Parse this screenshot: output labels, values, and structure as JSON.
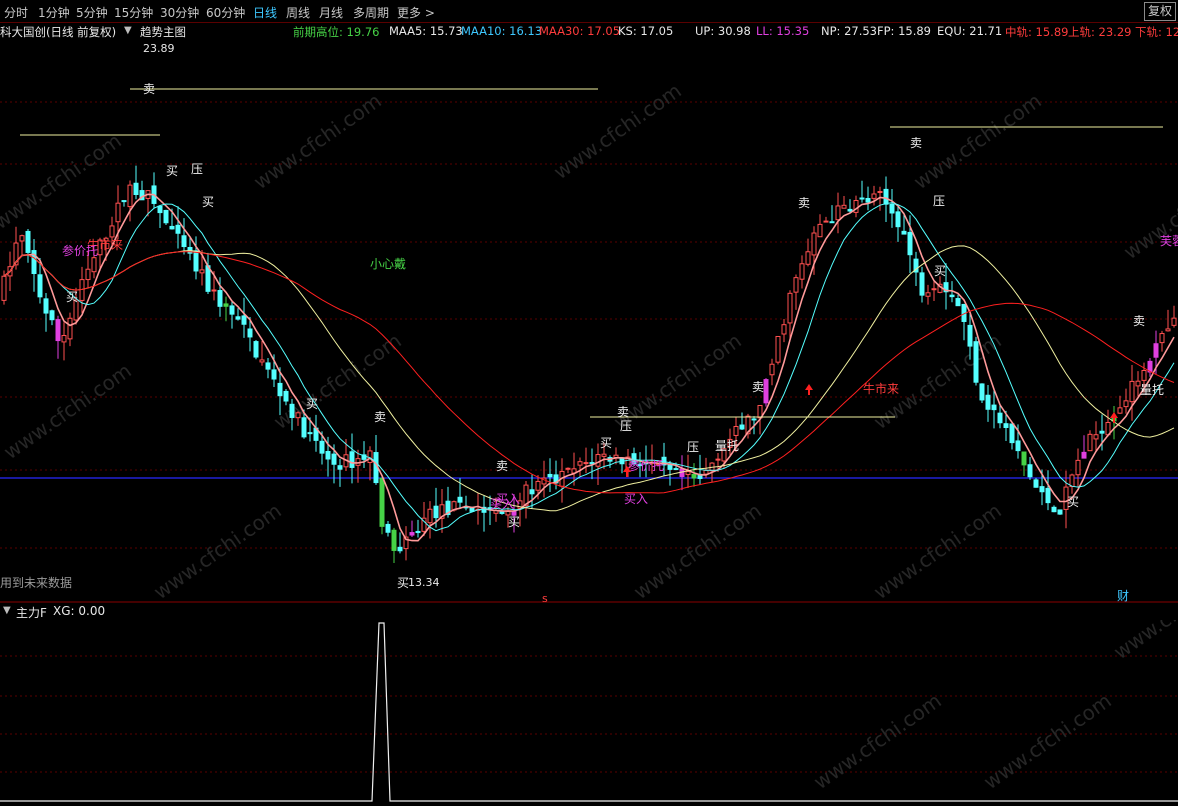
{
  "toolbar": {
    "periods": [
      {
        "label": "分时",
        "active": false
      },
      {
        "label": "1分钟",
        "active": false
      },
      {
        "label": "5分钟",
        "active": false
      },
      {
        "label": "15分钟",
        "active": false
      },
      {
        "label": "30分钟",
        "active": false
      },
      {
        "label": "60分钟",
        "active": false
      },
      {
        "label": "日线",
        "active": true
      },
      {
        "label": "周线",
        "active": false
      },
      {
        "label": "月线",
        "active": false
      },
      {
        "label": "多周期",
        "active": false
      },
      {
        "label": "更多 >",
        "active": false
      }
    ],
    "restore_label": "复权"
  },
  "infobar": {
    "security": "科大国创(日线 前复权)",
    "indicator_name": "趋势主图",
    "items": [
      {
        "text": "前期高位: 19.76",
        "color": "#46d246"
      },
      {
        "text": "MAA5: 15.73",
        "color": "#e8e8e8"
      },
      {
        "text": "MAA10: 16.13",
        "color": "#3ec8ff"
      },
      {
        "text": "MAA30: 17.05",
        "color": "#ff3c3c"
      },
      {
        "text": "KS: 17.05",
        "color": "#e8e8e8"
      },
      {
        "text": "UP: 30.98",
        "color": "#e8e8e8"
      },
      {
        "text": "LL: 15.35",
        "color": "#e040e0"
      },
      {
        "text": "NP: 27.53",
        "color": "#e8e8e8"
      },
      {
        "text": "FP: 15.89",
        "color": "#e8e8e8"
      },
      {
        "text": "EQU: 21.71",
        "color": "#e8e8e8"
      },
      {
        "text": "中轨: 15.89",
        "color": "#ff3c3c"
      },
      {
        "text": "上轨: 23.29",
        "color": "#ff3c3c"
      },
      {
        "text": "下轨: 12.",
        "color": "#ff3c3c"
      }
    ]
  },
  "main_chart": {
    "high_label": "23.89",
    "low_label": "13.34",
    "warning_note": "用到未来数据",
    "center_note": "小心戴",
    "marker_s": "s",
    "marker_cai": "财",
    "signals": [
      {
        "text": "卖",
        "color": "#f0f0f0"
      },
      {
        "text": "卖",
        "color": "#f0f0f0"
      },
      {
        "text": "卖",
        "color": "#f0f0f0"
      },
      {
        "text": "卖",
        "color": "#f0f0f0"
      },
      {
        "text": "卖",
        "color": "#f0f0f0"
      },
      {
        "text": "卖",
        "color": "#f0f0f0"
      },
      {
        "text": "卖",
        "color": "#f0f0f0"
      },
      {
        "text": "卖",
        "color": "#f0f0f0"
      },
      {
        "text": "买",
        "color": "#f0f0f0"
      },
      {
        "text": "买",
        "color": "#f0f0f0"
      },
      {
        "text": "买",
        "color": "#f0f0f0"
      },
      {
        "text": "买",
        "color": "#f0f0f0"
      },
      {
        "text": "买",
        "color": "#f0f0f0"
      },
      {
        "text": "买",
        "color": "#f0f0f0"
      },
      {
        "text": "买",
        "color": "#f0f0f0"
      },
      {
        "text": "买",
        "color": "#f0f0f0"
      },
      {
        "text": "买",
        "color": "#f0f0f0"
      },
      {
        "text": "压",
        "color": "#f0f0f0"
      },
      {
        "text": "压",
        "color": "#f0f0f0"
      },
      {
        "text": "压",
        "color": "#f0f0f0"
      },
      {
        "text": "压",
        "color": "#f0f0f0"
      },
      {
        "text": "量托",
        "color": "#f0f0f0"
      },
      {
        "text": "量托",
        "color": "#f0f0f0"
      },
      {
        "text": "牛市来",
        "color": "#ff3c3c"
      },
      {
        "text": "牛市来",
        "color": "#ff3c3c"
      },
      {
        "text": "参价托",
        "color": "#e040e0"
      },
      {
        "text": "参价托",
        "color": "#e040e0"
      },
      {
        "text": "买入",
        "color": "#e040e0"
      },
      {
        "text": "买入",
        "color": "#e040e0"
      },
      {
        "text": "买入",
        "color": "#e040e0"
      },
      {
        "text": "芙蓉",
        "color": "#e040e0"
      }
    ]
  },
  "sub_chart": {
    "title": "主力F",
    "value_text": "XG: 0.00"
  },
  "watermark": "www.cfchi.com",
  "colors": {
    "background": "#000000",
    "grid": "#5a0000",
    "up_candle": "#ff5050",
    "down_candle": "#54ffff",
    "ma_short": "#ff9a9a",
    "ma_mid": "#54ffff",
    "ma_long": "#f0f0a0",
    "ma_red": "#ff2020",
    "blue_line": "#2828ff",
    "resistance": "#f0f0a0"
  }
}
